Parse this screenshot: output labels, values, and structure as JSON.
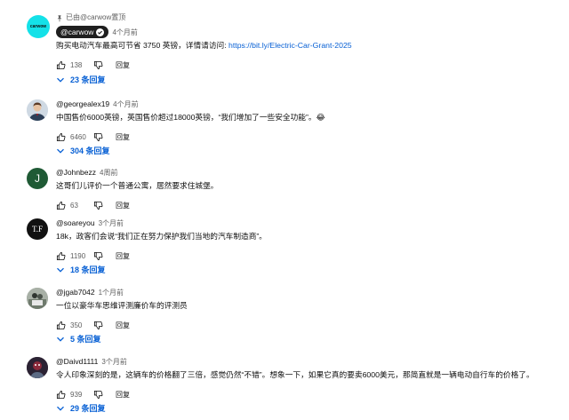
{
  "comments": [
    {
      "pinned_label": "已由@carwow置顶",
      "author": "@carwow",
      "time": "4个月前",
      "text": "购买电动汽车最高可节省 3750 英镑，详情请访问: ",
      "link": "https://bit.ly/Electric-Car-Grant-2025",
      "likes": "138",
      "reply_label": "回复",
      "replies": "23 条回复",
      "avatar_text": "carwow"
    },
    {
      "author": "@georgealex19",
      "time": "4个月前",
      "text": "中国售价6000英镑，英国售价超过18000英镑，“我们增加了一些安全功能”。😂",
      "likes": "6460",
      "reply_label": "回复",
      "replies": "304 条回复"
    },
    {
      "author": "@Johnbezz",
      "time": "4周前",
      "text": "这哥们儿评价一个普通公寓，居然要求住城堡。",
      "likes": "63",
      "reply_label": "回复",
      "avatar_text": "J"
    },
    {
      "author": "@soareyou",
      "time": "3个月前",
      "text": "18k，政客们会说“我们正在努力保护我们当地的汽车制造商”。",
      "likes": "1190",
      "reply_label": "回复",
      "replies": "18 条回复",
      "avatar_text": "T.F"
    },
    {
      "author": "@jgab7042",
      "time": "1个月前",
      "text": "一位以豪华车思维评测廉价车的评测员",
      "likes": "350",
      "reply_label": "回复",
      "replies": "5 条回复"
    },
    {
      "author": "@Daivd1111",
      "time": "3个月前",
      "text": "令人印象深刻的是，这辆车的价格翻了三倍，感觉仍然“不错”。想象一下，如果它真的要卖6000美元，那简直就是一辆电动自行车的价格了。",
      "likes": "939",
      "reply_label": "回复",
      "replies": "29 条回复"
    }
  ],
  "colors": {
    "link": "#065fd4",
    "secondary": "#606060",
    "avatar_j": "#1f5a35"
  }
}
